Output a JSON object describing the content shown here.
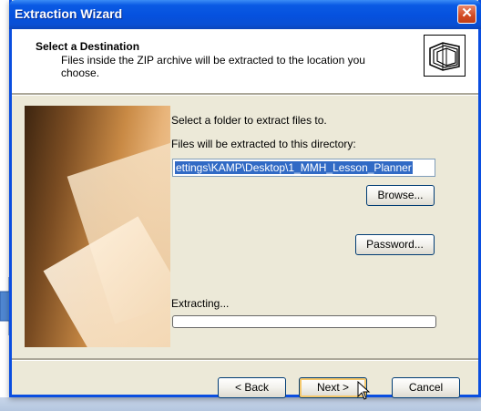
{
  "window": {
    "title": "Extraction Wizard"
  },
  "header": {
    "title": "Select a Destination",
    "subtitle": "Files inside the ZIP archive will be extracted to the location you choose.",
    "icon": "archive-folders-icon"
  },
  "main": {
    "select_folder_label": "Select a folder to extract files to.",
    "directory_label": "Files will be extracted to this directory:",
    "directory_value": "ettings\\KAMP\\Desktop\\1_MMH_Lesson_Planner",
    "browse_label": "Browse...",
    "password_label": "Password...",
    "extracting_label": "Extracting...",
    "progress": 0
  },
  "footer": {
    "back_label": "< Back",
    "next_label": "Next >",
    "cancel_label": "Cancel"
  },
  "colors": {
    "title_bar": "#0a5ae4",
    "close_button": "#d24a21",
    "selection": "#316ac5",
    "arrow": "#4f86d0"
  }
}
